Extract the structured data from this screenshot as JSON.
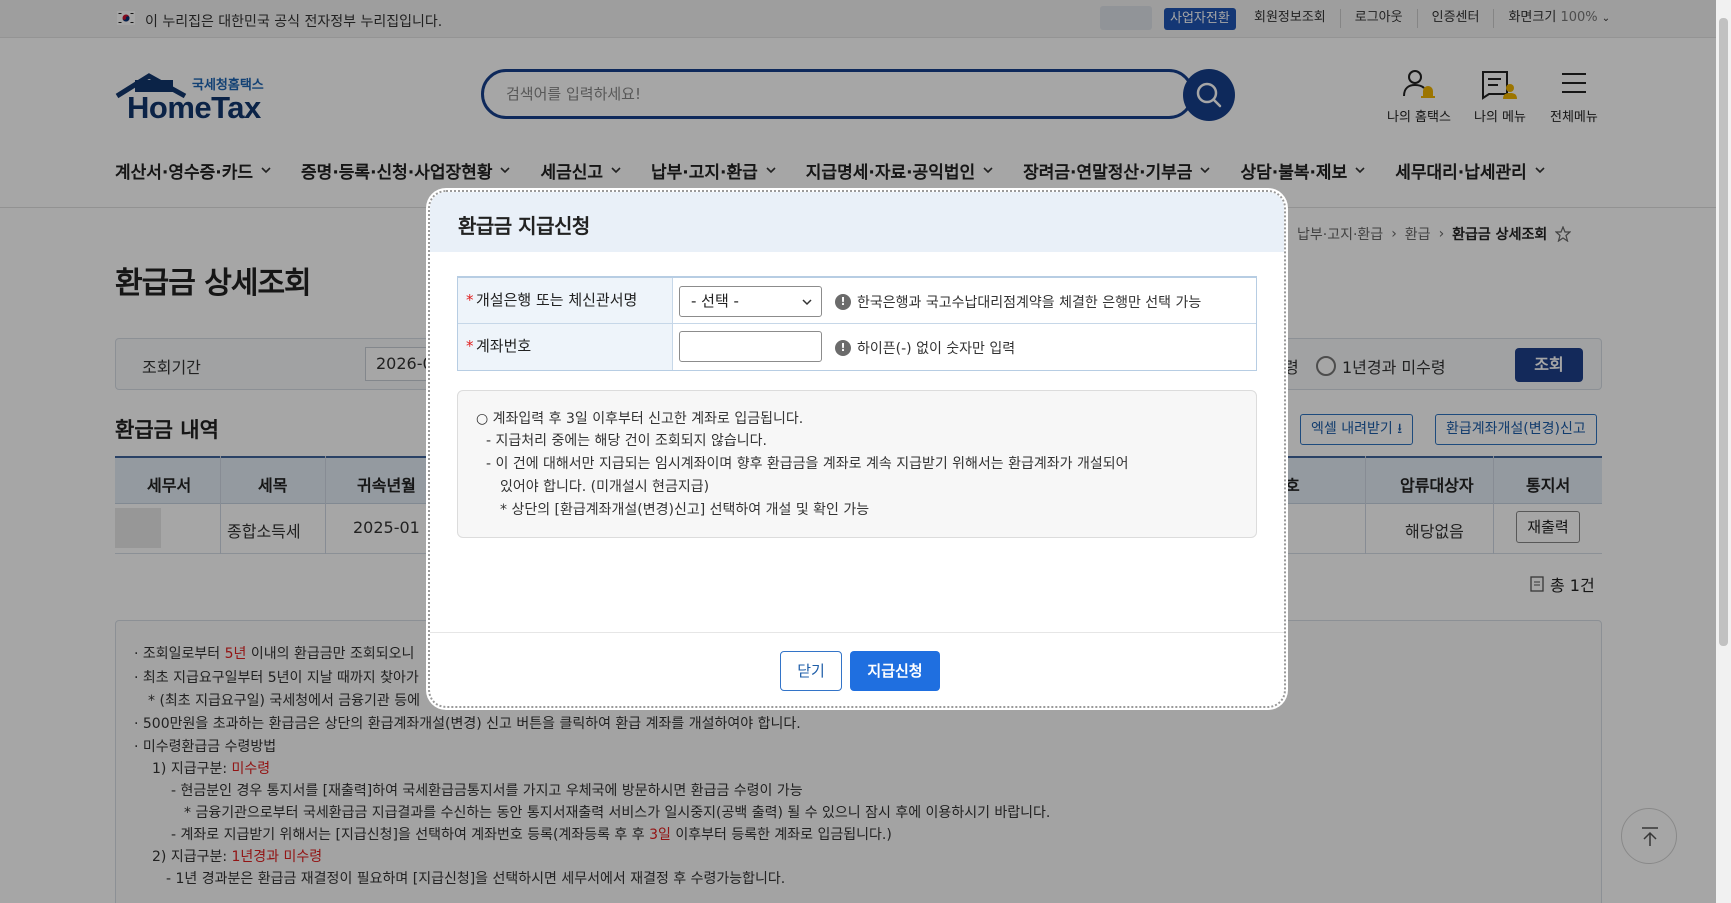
{
  "gov_bar": {
    "text": "이 누리집은 대한민국 공식 전자정부 누리집입니다.",
    "biz_switch": "사업자전환",
    "links": [
      "회원정보조회",
      "로그아웃",
      "인증센터"
    ],
    "zoom_label": "화면크기",
    "zoom_value": "100%"
  },
  "header": {
    "logo_small": "국세청홈택스",
    "logo_big": "HomeTax",
    "search_placeholder": "검색어를 입력하세요!",
    "my_hometax": "나의 홈택스",
    "my_menu": "나의 메뉴",
    "all_menu": "전체메뉴"
  },
  "gnb": [
    "계산서·영수증·카드",
    "증명·등록·신청·사업장현황",
    "세금신고",
    "납부·고지·환급",
    "지급명세·자료·공익법인",
    "장려금·연말정산·기부금",
    "상담·불복·제보",
    "세무대리·납세관리"
  ],
  "breadcrumb": [
    "납부·고지·환급",
    "환급",
    "환급금 상세조회"
  ],
  "page": {
    "title": "환급금 상세조회",
    "filter_label": "조회기간",
    "date_value": "2026-0",
    "radio_partial": "령",
    "radio_label": "1년경과 미수령",
    "search_btn": "조회",
    "section_title": "환급금 내역",
    "excel_btn": "엑셀 내려받기",
    "account_btn": "환급계좌개설(변경)신고",
    "total": "총 1건"
  },
  "table": {
    "headers": [
      "세무서",
      "세목",
      "귀속년월",
      "호",
      "압류대상자",
      "통지서"
    ],
    "row": {
      "tax_item": "종합소득세",
      "period": "2025-01",
      "seizure": "해당없음",
      "reprint": "재출력"
    }
  },
  "notes": {
    "n1a": "· 조회일로부터 ",
    "n1b": "5년",
    "n1c": " 이내의 환급금만 조회되오니",
    "n2": "· 최초 지급요구일부터 5년이 지날 때까지 찾아가",
    "n3": "* (최초 지급요구일) 국세청에서 금융기관 등에",
    "n4": "· 500만원을 초과하는 환급금은 상단의 환급계좌개설(변경) 신고 버튼을 클릭하여 환급 계좌를 개설하여야 합니다.",
    "n5": "· 미수령환급금 수령방법",
    "n6a": "1) 지급구분: ",
    "n6b": "미수령",
    "n7": "- 현금분인 경우 통지서를 [재출력]하여 국세환급금통지서를 가지고 우체국에 방문하시면 환급금 수령이 가능",
    "n8": "* 금융기관으로부터 국세환급금 지급결과를 수신하는 동안 통지서재출력 서비스가 일시중지(공백 출력) 될 수 있으니 잠시 후에 이용하시기 바랍니다.",
    "n9a": "- 계좌로 지급받기 위해서는 [지급신청]을 선택하여 계좌번호 등록(계좌등록 후 후 ",
    "n9b": "3일",
    "n9c": " 이후부터 등록한 계좌로 입금됩니다.)",
    "n10a": "2) 지급구분: ",
    "n10b": "1년경과 미수령",
    "n11": "- 1년 경과분은 환급금 재결정이 필요하며 [지급신청]을 선택하시면 세무서에서 재결정 후 수령가능합니다."
  },
  "modal": {
    "title": "환급금 지급신청",
    "bank_label": "개설은행 또는 체신관서명",
    "bank_select": "- 선택 -",
    "bank_hint": "한국은행과 국고수납대리점계약을 체결한 은행만 선택 가능",
    "account_label": "계좌번호",
    "account_value": "",
    "account_hint": "하이픈(-) 없이 숫자만 입력",
    "info1": "○ 계좌입력 후 3일 이후부터 신고한 계좌로 입금됩니다.",
    "info2": "- 지급처리 중에는 해당 건이 조회되지 않습니다.",
    "info3": "- 이 건에 대해서만 지급되는 임시계좌이며 향후 환급금을 계좌로 계속 지급받기 위해서는 환급계좌가 개설되어",
    "info4": "있어야 합니다. (미개설시 현금지급)",
    "info5": "* 상단의 [환급계좌개설(변경)신고] 선택하여 개설 및 확인 가능",
    "close_btn": "닫기",
    "apply_btn": "지급신청",
    "required_mark": "*"
  },
  "colors": {
    "brand_navy": "#16408d",
    "primary_blue": "#1f6fe0",
    "required_red": "#e02020"
  }
}
